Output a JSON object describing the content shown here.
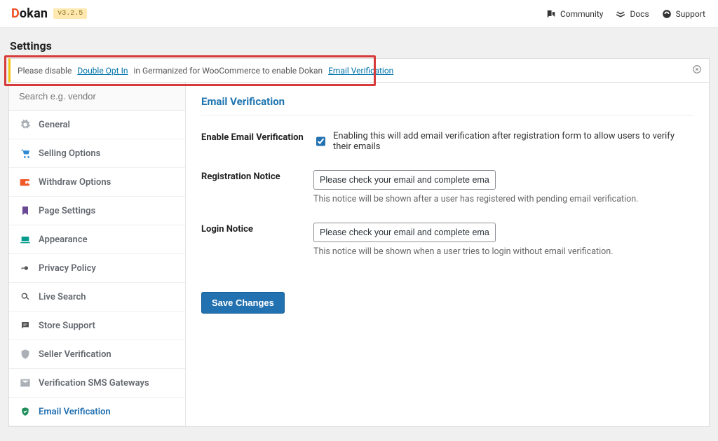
{
  "brand": {
    "name_part1": "D",
    "name_part2": "okan",
    "version": "v3.2.5"
  },
  "topnav": {
    "community": "Community",
    "docs": "Docs",
    "support": "Support"
  },
  "page_title": "Settings",
  "notice": {
    "pre": "Please disable ",
    "link1": "Double Opt In",
    "mid": " in Germanized for WooCommerce to enable Dokan ",
    "link2": "Email Verification"
  },
  "search_placeholder": "Search e.g. vendor",
  "sidebar": {
    "items": [
      {
        "label": "General",
        "icon": "gear",
        "color": "c-gray"
      },
      {
        "label": "Selling Options",
        "icon": "cart",
        "color": "c-blue"
      },
      {
        "label": "Withdraw Options",
        "icon": "wallet",
        "color": "c-orange"
      },
      {
        "label": "Page Settings",
        "icon": "bookmark",
        "color": "c-purple"
      },
      {
        "label": "Appearance",
        "icon": "appearance",
        "color": "c-teal"
      },
      {
        "label": "Privacy Policy",
        "icon": "key",
        "color": "c-dark"
      },
      {
        "label": "Live Search",
        "icon": "search",
        "color": "c-dark"
      },
      {
        "label": "Store Support",
        "icon": "chat",
        "color": "c-dark"
      },
      {
        "label": "Seller Verification",
        "icon": "shield",
        "color": "c-gray"
      },
      {
        "label": "Verification SMS Gateways",
        "icon": "envelope",
        "color": "c-gray"
      },
      {
        "label": "Email Verification",
        "icon": "shield_check",
        "color": "c-green",
        "active": true
      }
    ]
  },
  "form": {
    "title": "Email Verification",
    "enable": {
      "label": "Enable Email Verification",
      "checked": true,
      "desc": "Enabling this will add email verification after registration form to allow users to verify their emails"
    },
    "registration": {
      "label": "Registration Notice",
      "value": "Please check your email and complete email verific",
      "help": "This notice will be shown after a user has registered with pending email verification."
    },
    "login": {
      "label": "Login Notice",
      "value": "Please check your email and complete email verific",
      "help": "This notice will be shown when a user tries to login without email verification."
    },
    "save": "Save Changes"
  }
}
